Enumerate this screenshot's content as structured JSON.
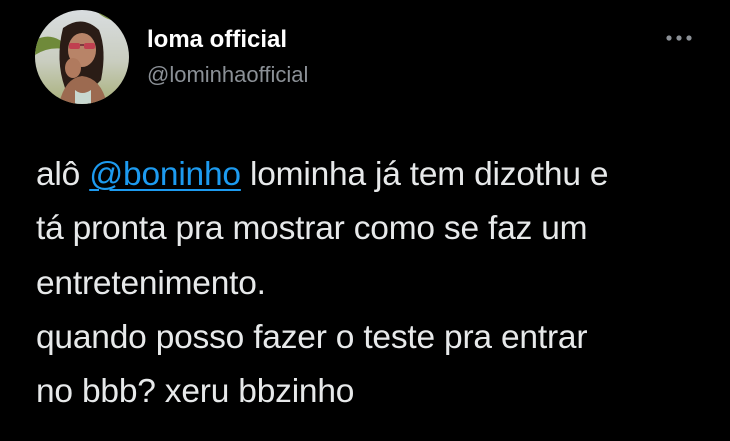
{
  "author": {
    "display_name": "loma official",
    "handle": "@lominhaofficial",
    "avatar_icon": "profile-photo"
  },
  "more_icon": "more-horizontal-icon",
  "tweet": {
    "line1_pre": "alô ",
    "mention": "@boninho",
    "line1_post": " lominha já tem dizothu e",
    "line2": "tá pronta pra mostrar como se faz um",
    "line3": "entretenimento.",
    "line4": "quando posso fazer o teste pra entrar",
    "line5": "no bbb? xeru bbzinho"
  },
  "colors": {
    "background": "#000000",
    "text": "#e7e9ea",
    "secondary": "#8b9096",
    "link": "#1d9bf0"
  }
}
